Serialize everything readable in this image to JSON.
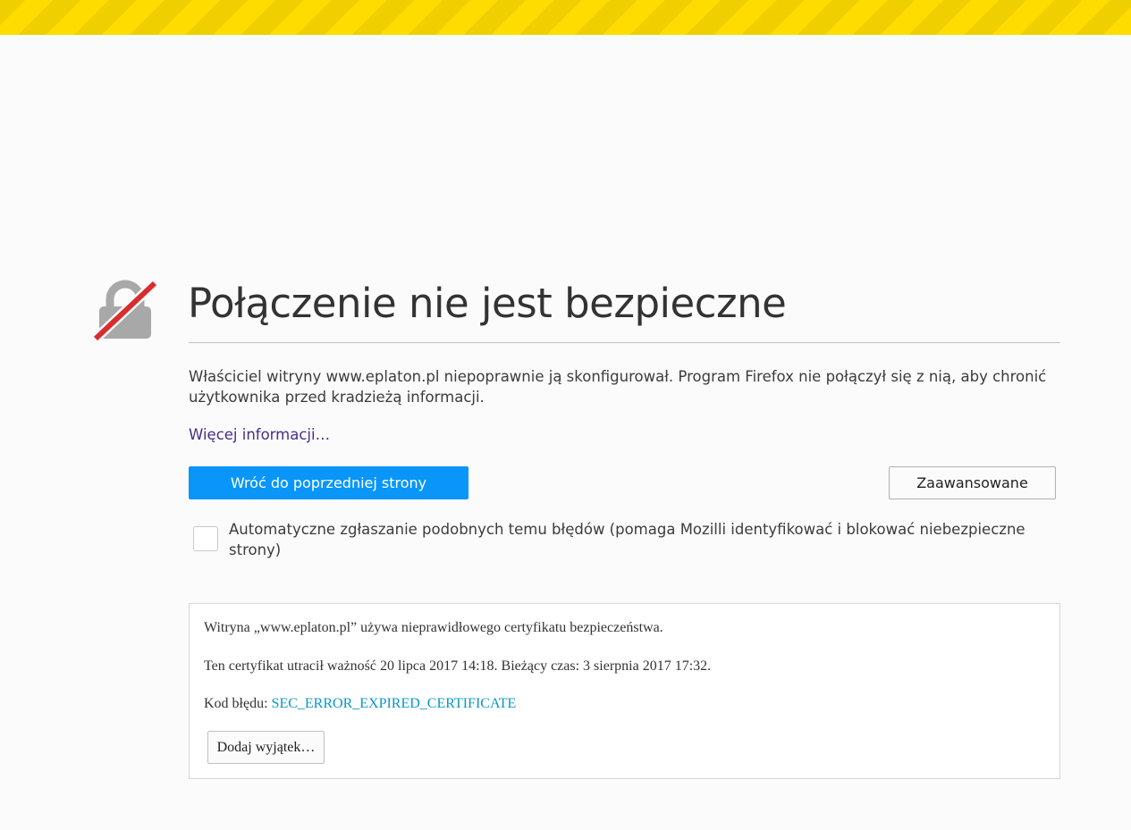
{
  "page": {
    "title": "Połączenie nie jest bezpieczne",
    "description": "Właściciel witryny www.eplaton.pl niepoprawnie ją skonfigurował. Program Firefox nie połączył się z nią, aby chronić użytkownika przed kradzieżą informacji.",
    "more_info": "Więcej informacji…"
  },
  "buttons": {
    "back": "Wróć do poprzedniej strony",
    "advanced": "Zaawansowane",
    "add_exception": "Dodaj wyjątek…"
  },
  "report": {
    "label": "Automatyczne zgłaszanie podobnych temu błędów (pomaga Mozilli identyfikować i blokować niebezpieczne strony)",
    "checked": false
  },
  "advanced_panel": {
    "line1": "Witryna „www.eplaton.pl” używa nieprawidłowego certyfikatu bezpieczeństwa.",
    "line2": "Ten certyfikat utracił ważność 20 lipca 2017 14:18. Bieżący czas: 3 sierpnia 2017 17:32.",
    "error_label": "Kod błędu: ",
    "error_code": "SEC_ERROR_EXPIRED_CERTIFICATE"
  },
  "icons": {
    "main": "broken-lock-icon"
  },
  "colors": {
    "warning_stripe": "#ffdc00",
    "primary_button": "#0996f8",
    "link_visited": "#4c2c8a",
    "error_code": "#0996c8",
    "lock_slash": "#d92d2d"
  }
}
